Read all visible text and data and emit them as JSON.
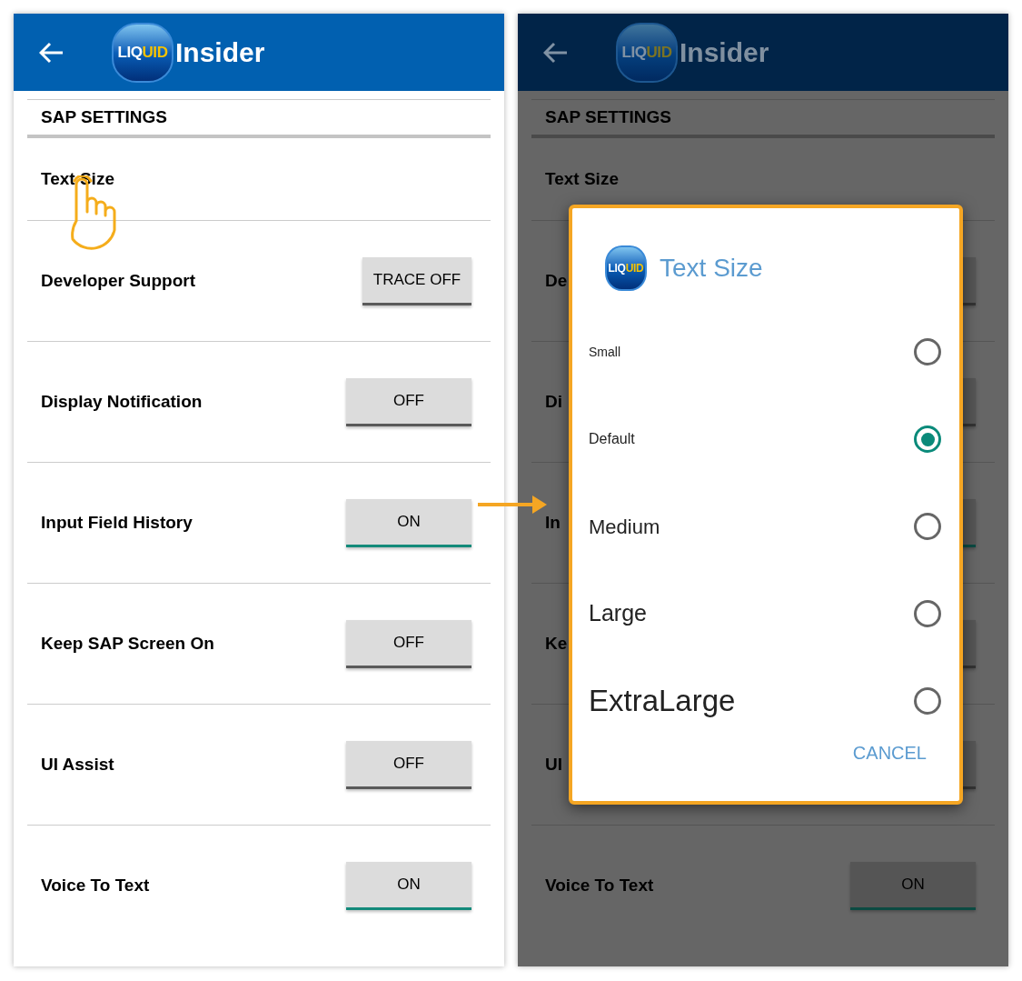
{
  "screens": [
    {
      "dimmed": false,
      "header": {
        "logo": [
          "LIQ",
          "UID"
        ],
        "title": "Insider"
      },
      "section": "SAP SETTINGS",
      "rows": [
        {
          "label": "Text Size"
        },
        {
          "label": "Developer Support",
          "button": {
            "label": "TRACE OFF",
            "on": false
          }
        },
        {
          "label": "Display Notification",
          "button": {
            "label": "OFF",
            "on": false
          }
        },
        {
          "label": "Input Field History",
          "button": {
            "label": "ON",
            "on": true
          }
        },
        {
          "label": "Keep SAP Screen On",
          "button": {
            "label": "OFF",
            "on": false
          }
        },
        {
          "label": "UI Assist",
          "button": {
            "label": "OFF",
            "on": false
          }
        },
        {
          "label": "Voice To Text",
          "button": {
            "label": "ON",
            "on": true
          }
        }
      ]
    },
    {
      "dimmed": true,
      "header": {
        "logo": [
          "LIQ",
          "UID"
        ],
        "title": "Insider"
      },
      "section": "SAP SETTINGS",
      "rows": [
        {
          "label": "Text Size"
        },
        {
          "label": "De",
          "button": {
            "on": false
          }
        },
        {
          "label": "Di",
          "button": {
            "on": false
          }
        },
        {
          "label": "In",
          "button": {
            "on": true
          }
        },
        {
          "label": "Ke",
          "button": {
            "on": false
          }
        },
        {
          "label": "UI",
          "button": {
            "on": false
          }
        },
        {
          "label": "Voice To Text",
          "button": {
            "label": "ON",
            "on": true
          }
        }
      ],
      "dialog": {
        "logo": [
          "LIQ",
          "UID"
        ],
        "title": "Text Size",
        "options": [
          {
            "label": "Small",
            "selected": false
          },
          {
            "label": "Default",
            "selected": true
          },
          {
            "label": "Medium",
            "selected": false
          },
          {
            "label": "Large",
            "selected": false
          },
          {
            "label": "ExtraLarge",
            "selected": false
          }
        ],
        "cancel": "CANCEL"
      }
    }
  ]
}
